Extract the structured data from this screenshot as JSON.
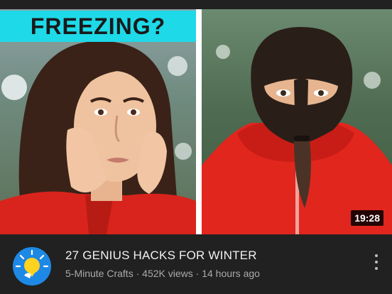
{
  "thumbnail": {
    "banner_text": "FREEZING?",
    "duration": "19:28"
  },
  "video": {
    "title": "27 GENIUS HACKS FOR WINTER",
    "channel": "5-Minute Crafts",
    "views": "452K views",
    "age": "14 hours ago",
    "separator": " · "
  },
  "icons": {
    "avatar": "lightbulb-logo-icon",
    "more": "more-vertical-icon"
  },
  "colors": {
    "banner": "#1ed9e8",
    "background": "#212121",
    "title": "#f1f1f1",
    "meta": "#aaaaaa",
    "avatar": "#1e88e5"
  }
}
